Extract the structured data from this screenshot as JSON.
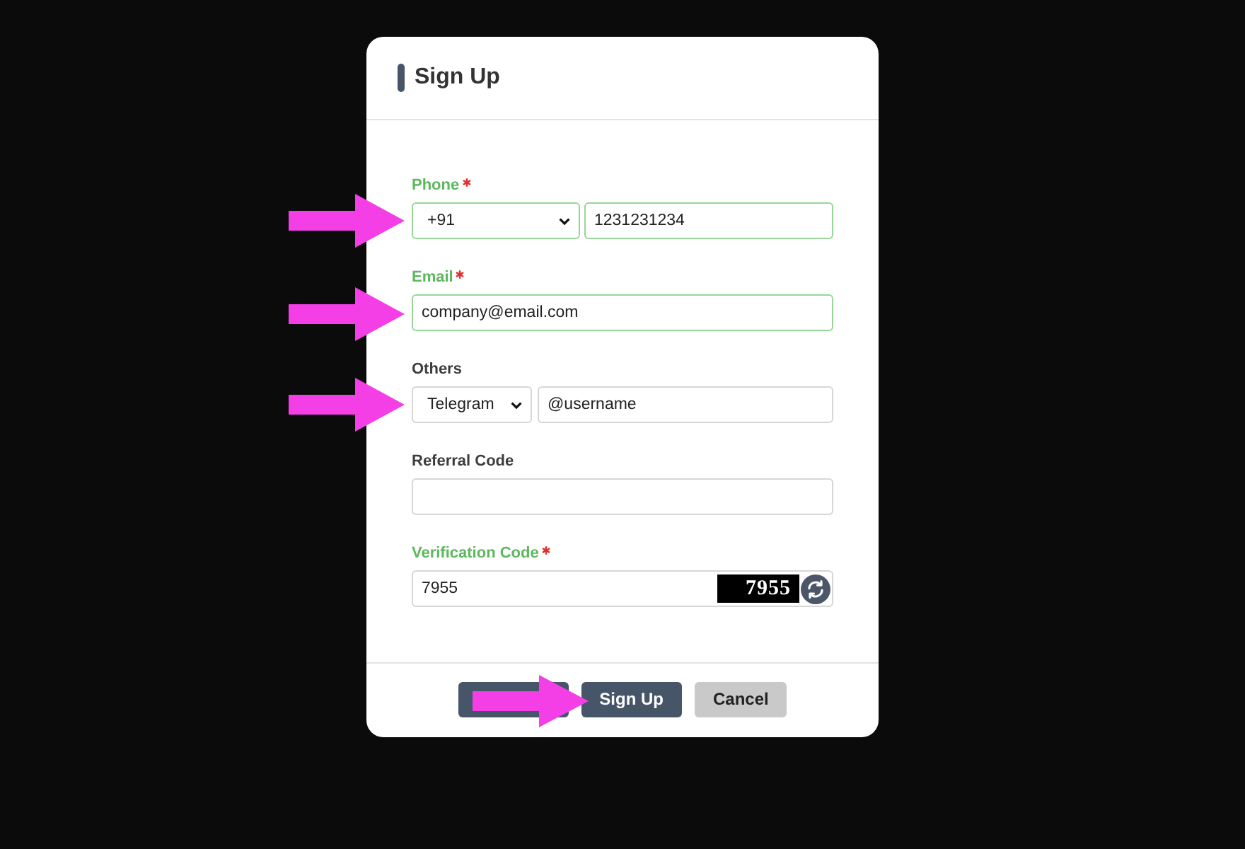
{
  "dialog": {
    "title": "Sign Up"
  },
  "fields": [
    {
      "kind": "phone",
      "label": "Phone",
      "required": true,
      "valid": true,
      "arrow": true,
      "select": {
        "value": "+91"
      },
      "input": {
        "value": "1231231234"
      }
    },
    {
      "kind": "email",
      "label": "Email",
      "required": true,
      "valid": true,
      "arrow": true,
      "input": {
        "value": "company@email.com"
      }
    },
    {
      "kind": "handle",
      "label": "Others",
      "required": false,
      "valid": false,
      "arrow": true,
      "select": {
        "value": "Telegram"
      },
      "input": {
        "value": "@username"
      }
    },
    {
      "kind": "referral",
      "label": "Referral Code",
      "required": false,
      "valid": false
    },
    {
      "kind": "captcha",
      "label": "Verification Code",
      "required": true,
      "valid": false,
      "input": {
        "value": "7955"
      },
      "captcha": "7955"
    }
  ],
  "buttons": [
    {
      "kind": "primary"
    },
    {
      "kind": "primary",
      "label": "Sign Up",
      "arrow": true
    },
    {
      "kind": "secondary",
      "label": "Cancel"
    }
  ]
}
